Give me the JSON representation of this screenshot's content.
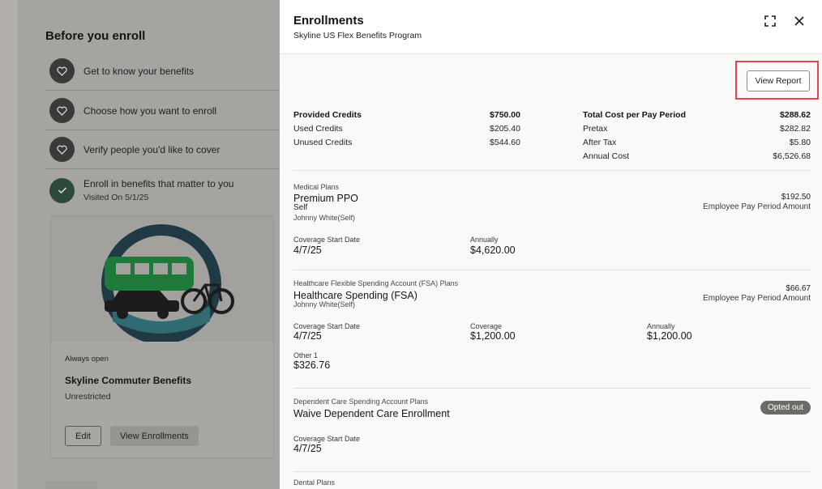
{
  "left": {
    "title": "Before you enroll",
    "steps": [
      {
        "label": "Get to know your benefits",
        "icon": "heart-icon"
      },
      {
        "label": "Choose how you want to enroll",
        "icon": "heart-icon"
      },
      {
        "label": "Verify people you'd like to cover",
        "icon": "heart-icon"
      },
      {
        "label": "Enroll in benefits that matter to you",
        "sub": "Visited On 5/1/25",
        "icon": "check-icon"
      }
    ],
    "card": {
      "tag": "Always open",
      "name": "Skyline Commuter Benefits",
      "status": "Unrestricted",
      "edit_label": "Edit",
      "view_label": "View Enrollments"
    }
  },
  "drawer": {
    "title": "Enrollments",
    "subtitle": "Skyline US Flex Benefits Program",
    "view_report_label": "View Report",
    "credits": {
      "provided_label": "Provided Credits",
      "provided_value": "$750.00",
      "used_label": "Used Credits",
      "used_value": "$205.40",
      "unused_label": "Unused Credits",
      "unused_value": "$544.60"
    },
    "cost": {
      "total_label": "Total Cost per Pay Period",
      "total_value": "$288.62",
      "pretax_label": "Pretax",
      "pretax_value": "$282.82",
      "aftertax_label": "After Tax",
      "aftertax_value": "$5.80",
      "annual_label": "Annual Cost",
      "annual_value": "$6,526.68"
    },
    "medical": {
      "category": "Medical Plans",
      "plan": "Premium PPO",
      "option": "Self",
      "covered": "Johnny White(Self)",
      "amount": "$192.50",
      "amount_label": "Employee Pay Period Amount",
      "start_label": "Coverage Start Date",
      "start_value": "4/7/25",
      "annual_label": "Annually",
      "annual_value": "$4,620.00"
    },
    "fsa": {
      "category": "Healthcare Flexible Spending Account (FSA) Plans",
      "plan": "Healthcare Spending (FSA)",
      "covered": "Johnny White(Self)",
      "amount": "$66.67",
      "amount_label": "Employee Pay Period Amount",
      "start_label": "Coverage Start Date",
      "start_value": "4/7/25",
      "coverage_label": "Coverage",
      "coverage_value": "$1,200.00",
      "annual_label": "Annually",
      "annual_value": "$1,200.00",
      "other_label": "Other 1",
      "other_value": "$326.76"
    },
    "dependent": {
      "category": "Dependent Care Spending Account Plans",
      "plan": "Waive Dependent Care Enrollment",
      "badge": "Opted out",
      "start_label": "Coverage Start Date",
      "start_value": "4/7/25"
    },
    "dental": {
      "category": "Dental Plans"
    }
  }
}
